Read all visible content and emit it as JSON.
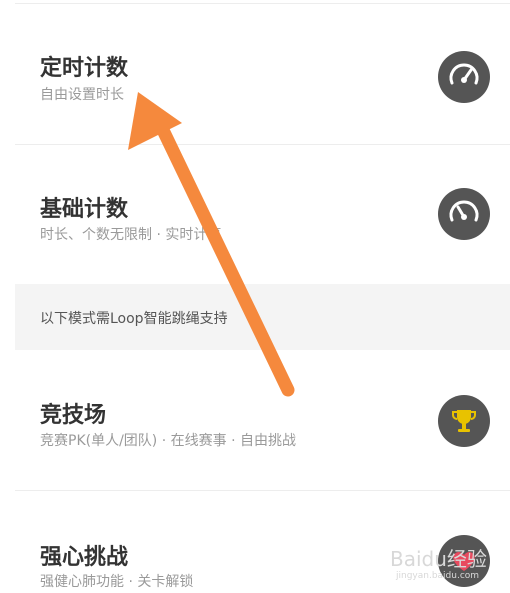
{
  "modes": [
    {
      "title": "定时计数",
      "subtitle": "自由设置时长",
      "icon": "gauge-icon"
    },
    {
      "title": "基础计数",
      "subtitle": "时长、个数无限制 · 实时计算",
      "icon": "gauge-icon"
    }
  ],
  "loop_section": {
    "header": "以下模式需Loop智能跳绳支持",
    "modes": [
      {
        "title": "竞技场",
        "subtitle": "竞赛PK(单人/团队) · 在线赛事 · 自由挑战",
        "icon": "trophy-icon"
      },
      {
        "title": "强心挑战",
        "subtitle": "强健心肺功能 · 关卡解锁",
        "icon": "heart-icon"
      }
    ]
  },
  "overlay": {
    "arrow_color": "#f5893d",
    "watermark_text": "Baidu经验",
    "watermark_url": "jingyan.baidu.com"
  },
  "colors": {
    "icon_bg": "#555555",
    "trophy": "#e8c200",
    "section_bg": "#f4f4f4"
  }
}
